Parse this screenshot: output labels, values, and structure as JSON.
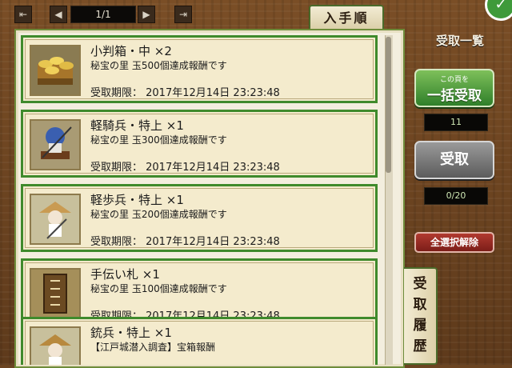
{
  "pager": {
    "first_icon": "first-page-icon",
    "prev_icon": "prev-page-icon",
    "next_icon": "next-page-icon",
    "last_icon": "last-page-icon",
    "count": "1/1"
  },
  "sort_tab": {
    "label": "入手順"
  },
  "items": [
    {
      "name": "小判箱・中 ×2",
      "desc": "秘宝の里 玉500個達成報酬です",
      "expiry": "受取期限： 2017年12月14日 23:23:48",
      "icon": "gold-koban-box-icon"
    },
    {
      "name": "軽騎兵・特上 ×1",
      "desc": "秘宝の里 玉300個達成報酬です",
      "expiry": "受取期限： 2017年12月14日 23:23:48",
      "icon": "light-cavalry-icon"
    },
    {
      "name": "軽歩兵・特上 ×1",
      "desc": "秘宝の里 玉200個達成報酬です",
      "expiry": "受取期限： 2017年12月14日 23:23:48",
      "icon": "light-infantry-icon"
    },
    {
      "name": "手伝い札 ×1",
      "desc": "秘宝の里 玉100個達成報酬です",
      "expiry": "受取期限： 2017年12月14日 23:23:48",
      "icon": "helper-card-icon"
    },
    {
      "name": "銃兵・特上 ×1",
      "desc": "【江戸城潜入調査】宝箱報酬",
      "expiry": "",
      "icon": "gunner-icon"
    }
  ],
  "history_tab": {
    "label": "受取履歴"
  },
  "right": {
    "title": "受取一覧",
    "bulk_small": "この頁を",
    "bulk_big": "一括受取",
    "bulk_count": "11",
    "receive_label": "受取",
    "receive_count": "0/20",
    "clear_label": "全選択解除"
  },
  "colors": {
    "card_border": "#3f8a2c",
    "bulk_button": "#2f7f2a",
    "clear_button": "#7c1d18"
  }
}
